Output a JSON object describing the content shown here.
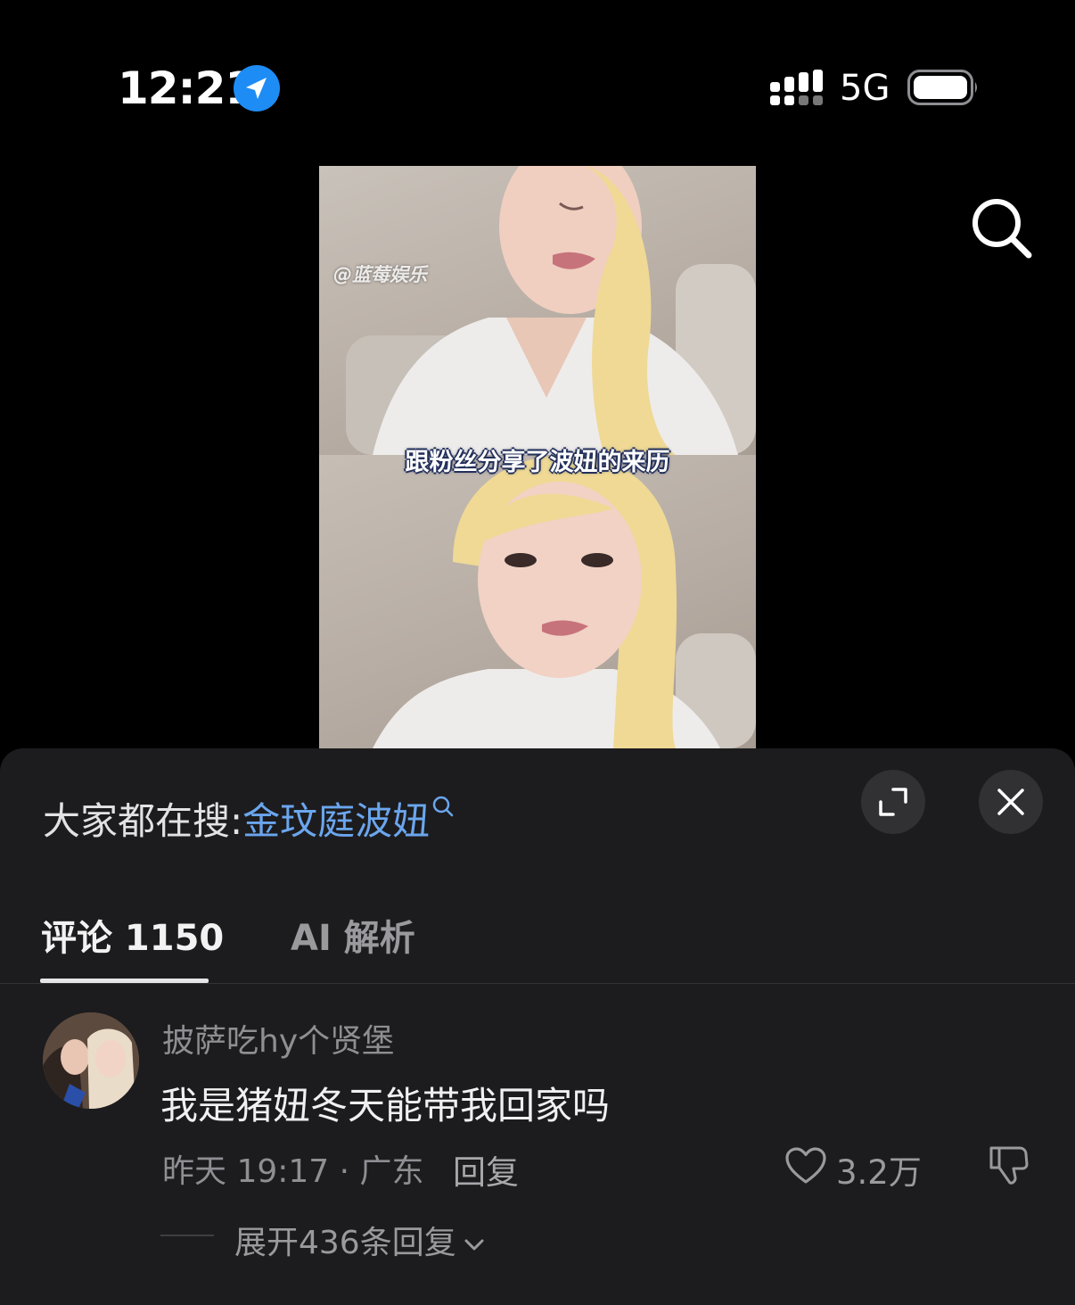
{
  "status_bar": {
    "time": "12:21",
    "network": "5G"
  },
  "video": {
    "watermark": "@蓝莓娱乐",
    "subtitle": "跟粉丝分享了波妞的来历"
  },
  "trending": {
    "prefix": "大家都在搜:",
    "term": "金玟庭波妞"
  },
  "tabs": [
    {
      "label": "评论 1150",
      "active": true
    },
    {
      "label": "AI 解析",
      "active": false
    }
  ],
  "comments": [
    {
      "username": "披萨吃hy个贤堡",
      "text": "我是猪妞冬天能带我回家吗",
      "time_location": "昨天 19:17 · 广东",
      "reply_label": "回复",
      "likes": "3.2万",
      "expand_label": "展开436条回复"
    }
  ],
  "colors": {
    "accent_link": "#6ba6ee",
    "location_badge": "#1e8cf5",
    "sheet_background": "#1c1c1e"
  },
  "icons": [
    "location-arrow-icon",
    "signal-icon",
    "battery-icon",
    "search-icon",
    "expand-icon",
    "close-icon",
    "heart-icon",
    "dislike-icon",
    "chevron-down-icon"
  ]
}
